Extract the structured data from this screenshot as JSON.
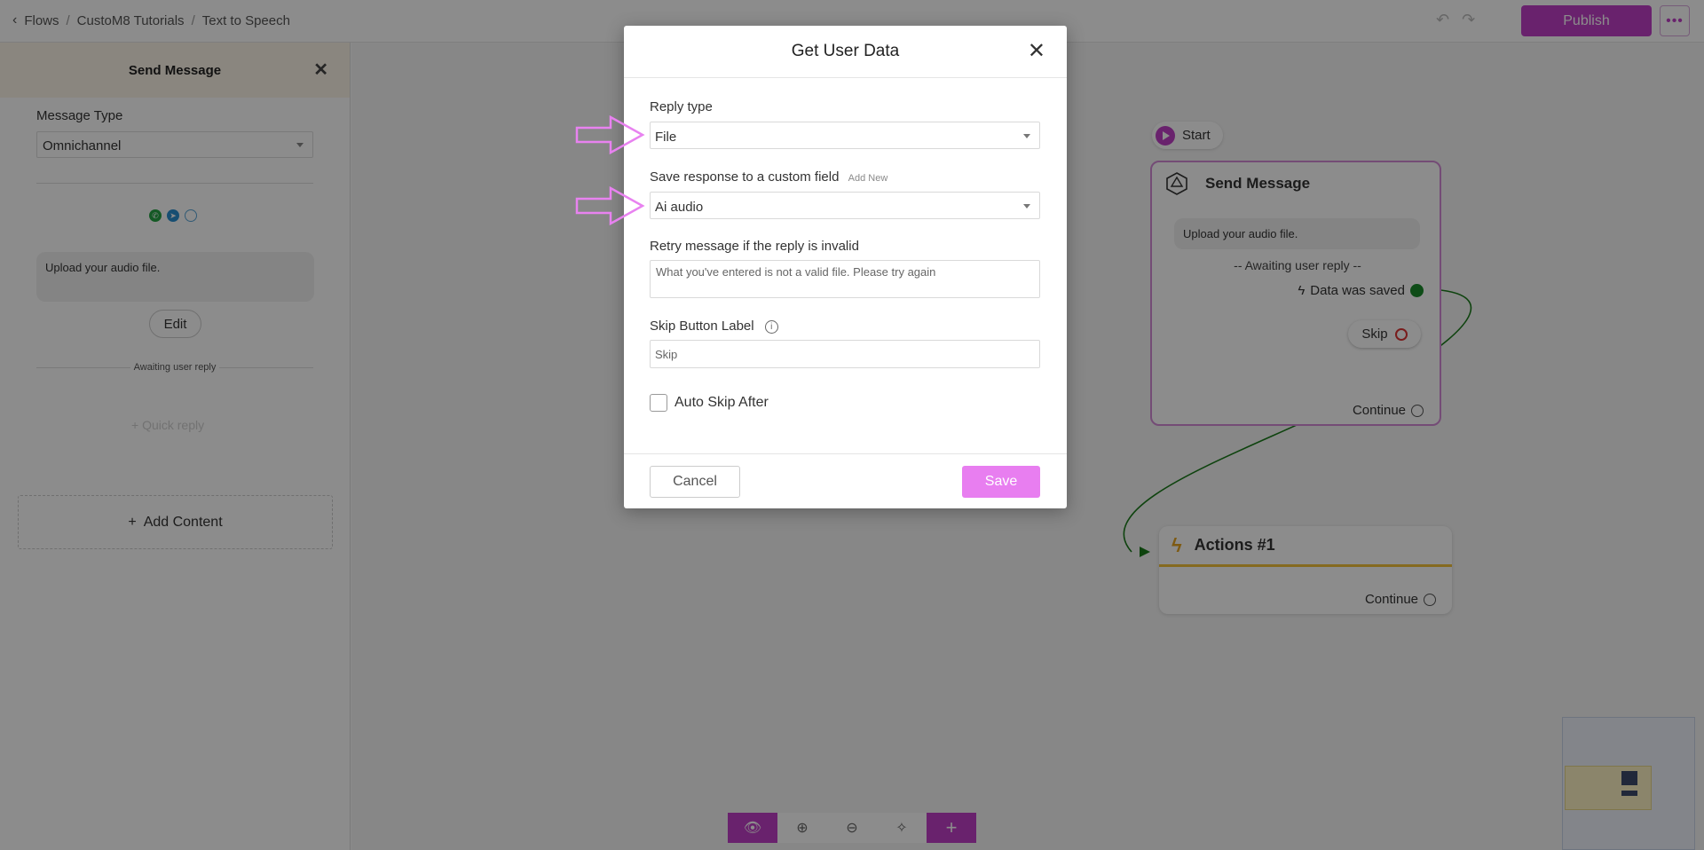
{
  "breadcrumb": {
    "items": [
      "Flows",
      "CustoM8 Tutorials",
      "Text to Speech"
    ]
  },
  "topbar": {
    "publish_label": "Publish",
    "more_label": "•••"
  },
  "sidebar": {
    "title": "Send Message",
    "message_type_label": "Message Type",
    "message_type_value": "Omnichannel",
    "message_text": "Upload your audio file.",
    "edit_label": "Edit",
    "awaiting_label": "Awaiting user reply",
    "quick_reply_label": "+ Quick reply",
    "add_content_label": "Add Content",
    "channel_icons": [
      "whatsapp-icon",
      "telegram-icon",
      "messenger-icon"
    ]
  },
  "canvas": {
    "start_label": "Start",
    "send_node": {
      "title": "Send Message",
      "message": "Upload your audio file.",
      "awaiting": "-- Awaiting user reply --",
      "data_saved_label": "Data was saved",
      "skip_label": "Skip",
      "continue_label": "Continue"
    },
    "actions_node": {
      "title": "Actions #1",
      "continue_label": "Continue"
    }
  },
  "modal": {
    "title": "Get User Data",
    "reply_type_label": "Reply type",
    "reply_type_value": "File",
    "custom_field_label": "Save response to a custom field",
    "add_new_label": "Add New",
    "custom_field_value": "Ai audio",
    "retry_label": "Retry message if the reply is invalid",
    "retry_value": "What you've entered is not a valid file. Please try again",
    "skip_button_label": "Skip Button Label",
    "skip_button_value": "Skip",
    "auto_skip_label": "Auto Skip After",
    "auto_skip_checked": false,
    "cancel_label": "Cancel",
    "save_label": "Save"
  },
  "colors": {
    "brand": "#c03fc6",
    "save_button": "#e87ef0",
    "annotation_arrow": "#e882f0",
    "success": "#1a8a2a",
    "actions_accent": "#f3c23a"
  }
}
